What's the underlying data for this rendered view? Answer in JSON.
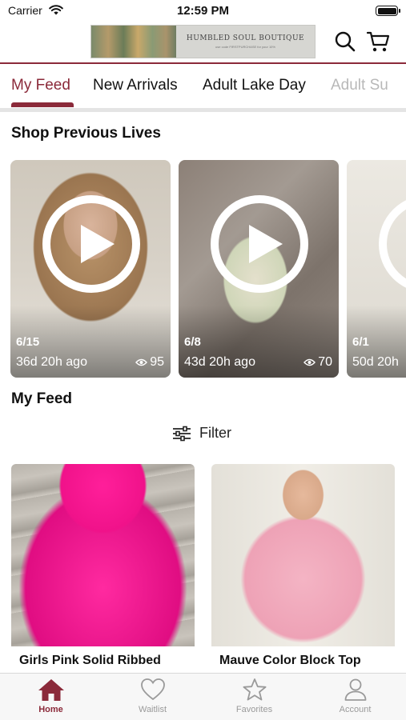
{
  "status_bar": {
    "carrier": "Carrier",
    "time": "12:59 PM"
  },
  "header": {
    "banner_name": "HUMBLED SOUL BOUTIQUE",
    "banner_sub": "use code FIRSTPURCHASE for your 10%",
    "icons": [
      "search-icon",
      "cart-icon"
    ]
  },
  "tabs": [
    {
      "label": "My Feed",
      "active": true
    },
    {
      "label": "New Arrivals",
      "active": false
    },
    {
      "label": "Adult Lake Day",
      "active": false
    },
    {
      "label": "Adult Su",
      "active": false
    }
  ],
  "shop_previous_lives": {
    "title": "Shop Previous Lives",
    "cards": [
      {
        "date": "6/15",
        "ago": "36d 20h ago",
        "views": "95"
      },
      {
        "date": "6/8",
        "ago": "43d 20h ago",
        "views": "70"
      },
      {
        "date": "6/1",
        "ago": "50d 20h",
        "views": ""
      }
    ]
  },
  "my_feed": {
    "title": "My Feed",
    "filter_label": "Filter",
    "products": [
      {
        "name": "Girls Pink Solid Ribbed"
      },
      {
        "name": "Mauve Color Block Top"
      }
    ]
  },
  "bottom_nav": {
    "items": [
      {
        "label": "Home",
        "icon": "home-icon",
        "active": true
      },
      {
        "label": "Waitlist",
        "icon": "heart-icon",
        "active": false
      },
      {
        "label": "Favorites",
        "icon": "star-icon",
        "active": false
      },
      {
        "label": "Account",
        "icon": "person-icon",
        "active": false
      }
    ]
  },
  "colors": {
    "accent": "#8b2a3a",
    "inactive": "#9a9a9a"
  }
}
